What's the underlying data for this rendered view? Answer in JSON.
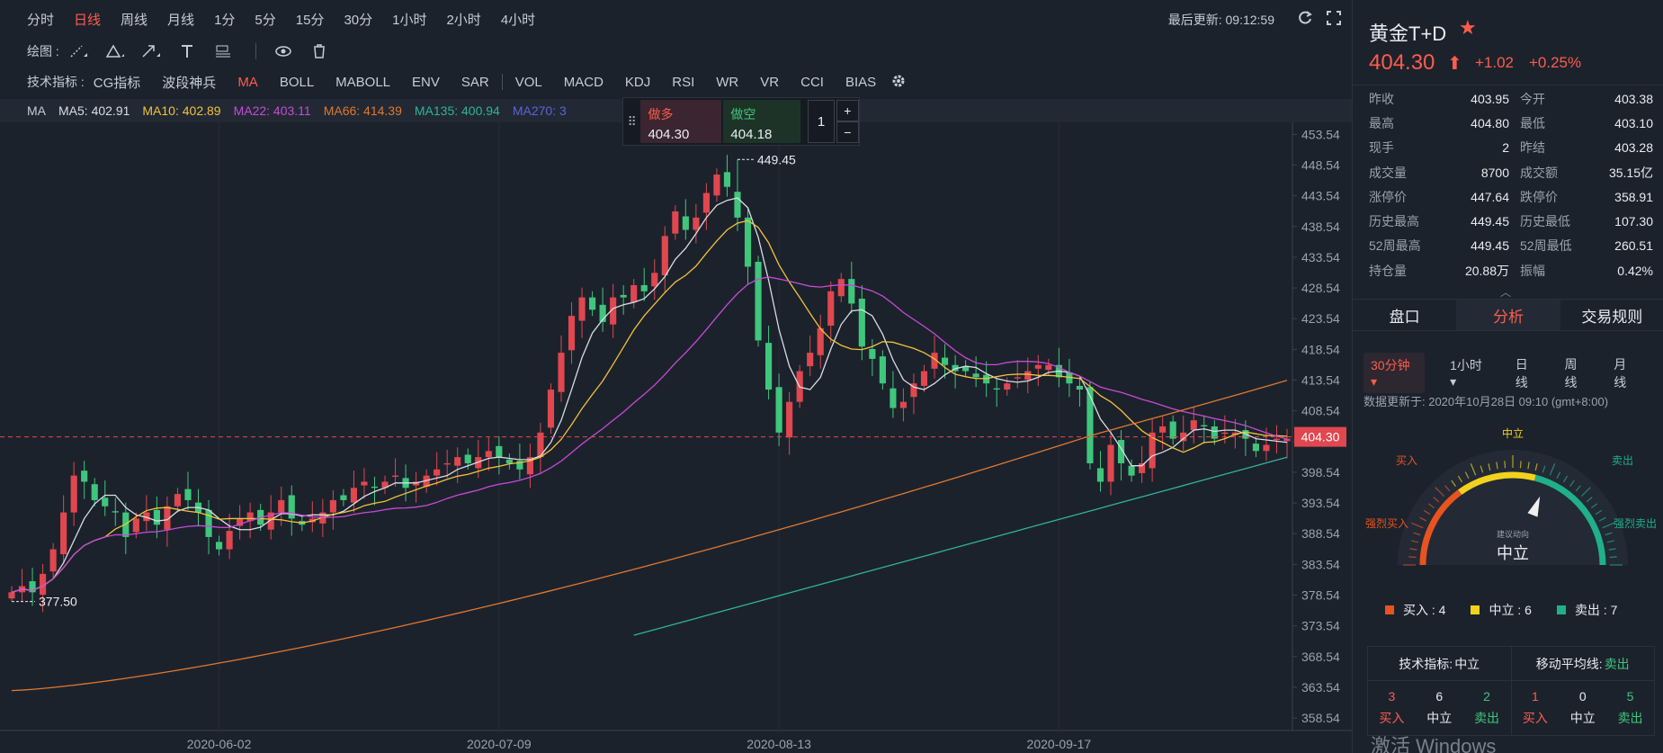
{
  "toolbar": {
    "periods": [
      "分时",
      "日线",
      "周线",
      "月线",
      "1分",
      "5分",
      "15分",
      "30分",
      "1小时",
      "2小时",
      "4小时"
    ],
    "active_period": "日线",
    "last_update_label": "最后更新:",
    "last_update_time": "09:12:59",
    "draw_label": "绘图 :",
    "indicator_label": "技术指标 :",
    "indicators_a": [
      "CG指标",
      "波段神兵",
      "MA",
      "BOLL",
      "MABOLL",
      "ENV",
      "SAR"
    ],
    "indicators_b": [
      "VOL",
      "MACD",
      "KDJ",
      "RSI",
      "WR",
      "VR",
      "CCI",
      "BIAS"
    ],
    "active_indicator": "MA"
  },
  "ma_legend": {
    "title": "MA",
    "items": [
      {
        "label": "MA5: 402.91",
        "color": "#d8dde4"
      },
      {
        "label": "MA10: 402.89",
        "color": "#f0c33a"
      },
      {
        "label": "MA22: 403.11",
        "color": "#c64bd6"
      },
      {
        "label": "MA66: 414.39",
        "color": "#e0782e"
      },
      {
        "label": "MA135: 400.94",
        "color": "#2fb39a"
      },
      {
        "label": "MA270: 3",
        "color": "#5a64d8"
      }
    ]
  },
  "trade": {
    "buy_label": "做多",
    "buy_price": "404.30",
    "sell_label": "做空",
    "sell_price": "404.18",
    "quantity": "1",
    "plus": "+",
    "minus": "−"
  },
  "chart_data": {
    "type": "candlestick",
    "yaxis_ticks": [
      "453.54",
      "448.54",
      "443.54",
      "438.54",
      "433.54",
      "428.54",
      "423.54",
      "418.54",
      "413.54",
      "408.54",
      "403.54",
      "398.54",
      "393.54",
      "388.54",
      "383.54",
      "378.54",
      "373.54",
      "368.54",
      "363.54",
      "358.54"
    ],
    "ylim": [
      356.5,
      455.5
    ],
    "xaxis_ticks": [
      {
        "label": "2020-06-02",
        "index": 20
      },
      {
        "label": "2020-07-09",
        "index": 47
      },
      {
        "label": "2020-08-13",
        "index": 74
      },
      {
        "label": "2020-09-17",
        "index": 101
      }
    ],
    "current_price": "404.30",
    "current_value": 404.3,
    "high_annotation": {
      "label": "449.45",
      "index": 70,
      "value": 449.45
    },
    "low_annotation": {
      "label": "377.50",
      "index": 0,
      "value": 377.5
    },
    "closes": [
      379,
      380,
      379,
      382,
      386,
      392,
      398,
      397,
      394,
      393,
      392,
      388,
      391,
      392,
      390,
      393,
      395,
      394,
      392,
      388,
      386,
      389,
      391,
      392,
      390,
      392,
      394,
      391,
      390,
      391,
      392,
      394,
      394,
      396,
      397,
      396,
      397,
      398,
      396,
      397,
      398,
      399,
      400,
      401,
      400,
      401,
      402,
      401,
      400,
      399,
      401,
      405,
      412,
      418,
      424,
      427,
      425,
      423,
      427,
      427,
      429,
      428,
      431,
      437,
      441,
      438,
      440,
      444,
      447,
      445,
      440,
      432,
      420,
      412,
      405,
      410,
      415,
      418,
      422,
      428,
      430,
      426,
      419,
      417,
      413,
      409,
      410,
      413,
      415,
      418,
      416,
      415,
      415,
      414,
      413,
      412,
      413,
      414,
      415,
      416,
      416,
      414,
      413,
      412,
      400,
      397,
      403,
      400,
      398,
      400,
      405,
      406,
      404,
      405,
      407,
      406,
      404,
      405,
      405,
      404,
      402,
      403,
      404,
      404
    ]
  },
  "symbol": {
    "name": "黄金T+D",
    "price": "404.30",
    "change": "+1.02",
    "change_pct": "+0.25%"
  },
  "stats": [
    {
      "k1": "昨收",
      "v1": "403.95",
      "k2": "今开",
      "v2": "403.38"
    },
    {
      "k1": "最高",
      "v1": "404.80",
      "k2": "最低",
      "v2": "403.10"
    },
    {
      "k1": "现手",
      "v1": "2",
      "k2": "昨结",
      "v2": "403.28"
    },
    {
      "k1": "成交量",
      "v1": "8700",
      "k2": "成交额",
      "v2": "35.15亿"
    },
    {
      "k1": "涨停价",
      "v1": "447.64",
      "k2": "跌停价",
      "v2": "358.91"
    },
    {
      "k1": "历史最高",
      "v1": "449.45",
      "k2": "历史最低",
      "v2": "107.30"
    },
    {
      "k1": "52周最高",
      "v1": "449.45",
      "k2": "52周最低",
      "v2": "260.51"
    },
    {
      "k1": "持仓量",
      "v1": "20.88万",
      "k2": "振幅",
      "v2": "0.42%"
    }
  ],
  "right_tabs": [
    "盘口",
    "分析",
    "交易规则"
  ],
  "active_right_tab": "分析",
  "analysis_periods": [
    "30分钟 ▾",
    "1小时 ▾",
    "日线",
    "周线",
    "月线"
  ],
  "data_update": "数据更新于: 2020年10月28日 09:10 (gmt+8:00)",
  "gauge": {
    "labels": {
      "strong_buy": "强烈买入",
      "buy": "买入",
      "neutral": "中立",
      "sell": "卖出",
      "strong_sell": "强烈卖出"
    },
    "sub_label": "建议动向",
    "result": "中立",
    "needle_fraction": 0.62
  },
  "legend": [
    {
      "label": "买入 : 4",
      "color": "#e8531f"
    },
    {
      "label": "中立 : 6",
      "color": "#f2d21c"
    },
    {
      "label": "卖出 : 7",
      "color": "#1fb08a"
    }
  ],
  "summary": {
    "tech_label": "技术指标:",
    "tech_result": "中立",
    "tech_counts": [
      {
        "n": "3",
        "l": "买入"
      },
      {
        "n": "6",
        "l": "中立"
      },
      {
        "n": "2",
        "l": "卖出"
      }
    ],
    "ma_label": "移动平均线:",
    "ma_result": "卖出",
    "ma_counts": [
      {
        "n": "1",
        "l": "买入"
      },
      {
        "n": "0",
        "l": "中立"
      },
      {
        "n": "5",
        "l": "卖出"
      }
    ]
  },
  "watermark": "激活 Windows"
}
